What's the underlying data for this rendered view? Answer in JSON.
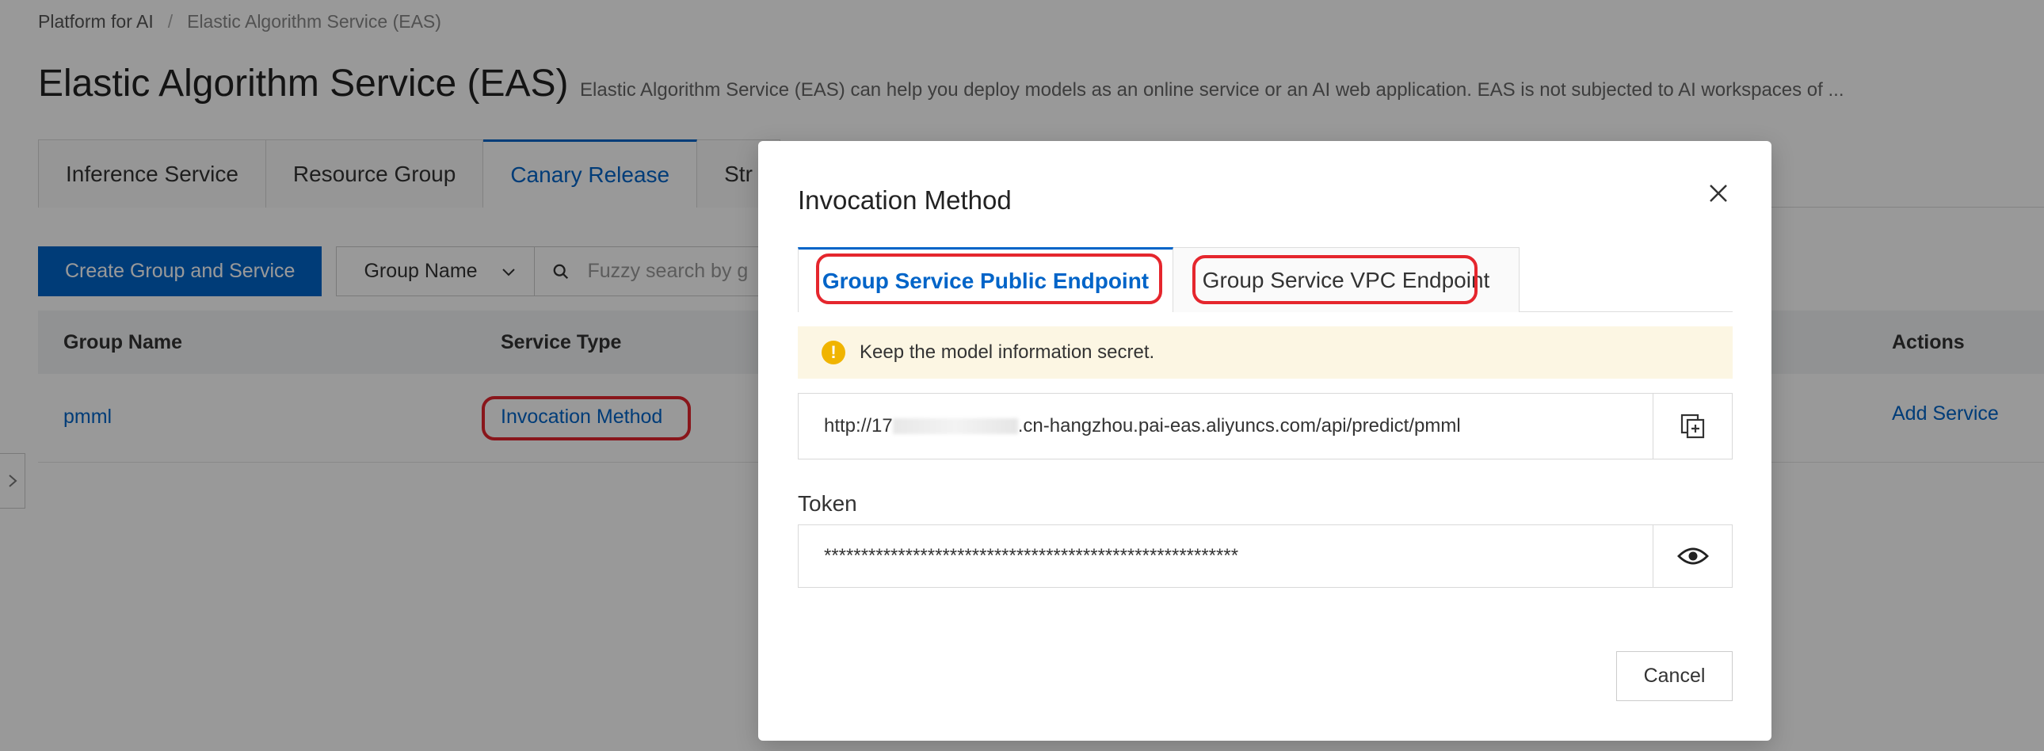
{
  "breadcrumb": [
    "Platform for AI",
    "Elastic Algorithm Service (EAS)"
  ],
  "page": {
    "title": "Elastic Algorithm Service (EAS)",
    "description": "Elastic Algorithm Service (EAS) can help you deploy models as an online service or an AI web application. EAS is not subjected to AI workspaces of ..."
  },
  "tabs": [
    {
      "label": "Inference Service",
      "active": false
    },
    {
      "label": "Resource Group",
      "active": false
    },
    {
      "label": "Canary Release",
      "active": true
    },
    {
      "label": "Str",
      "active": false
    }
  ],
  "toolbar": {
    "create_label": "Create Group and Service",
    "filter_select": "Group Name",
    "search_placeholder": "Fuzzy search by g"
  },
  "table": {
    "columns": [
      "Group Name",
      "Service Type",
      "Actions"
    ],
    "rows": [
      {
        "group_name": "pmml",
        "service_type": "Invocation Method",
        "action": "Add Service"
      }
    ]
  },
  "dialog": {
    "title": "Invocation Method",
    "tabs": [
      "Group Service Public Endpoint",
      "Group Service VPC Endpoint"
    ],
    "alert": "Keep the model information secret.",
    "url_prefix": "http://17",
    "url_suffix": ".cn-hangzhou.pai-eas.aliyuncs.com/api/predict/pmml",
    "token_label": "Token",
    "token_value": "********************************************************",
    "cancel_label": "Cancel"
  },
  "colors": {
    "primary": "#0064c8",
    "highlight": "#e5262d",
    "alert_bg": "#fcf6e3",
    "warning": "#f0b400"
  }
}
